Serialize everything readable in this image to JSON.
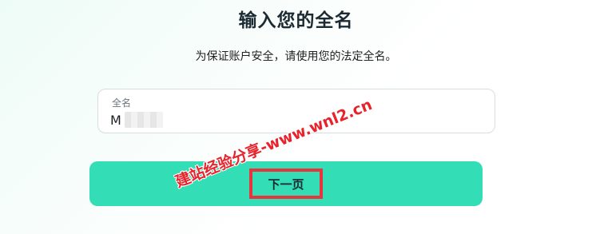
{
  "page": {
    "title": "输入您的全名",
    "subtitle": "为保证账户安全，请使用您的法定全名。"
  },
  "form": {
    "full_name_label": "全名",
    "full_name_value": "M      G"
  },
  "buttons": {
    "next_label": "下一页"
  },
  "watermark": {
    "text": "建站经验分享-www.wnl2.cn"
  },
  "colors": {
    "primary_button": "#33deb6",
    "highlight_border": "#e8343c",
    "watermark": "#e8232b",
    "background_tint": "#eefcf7"
  }
}
